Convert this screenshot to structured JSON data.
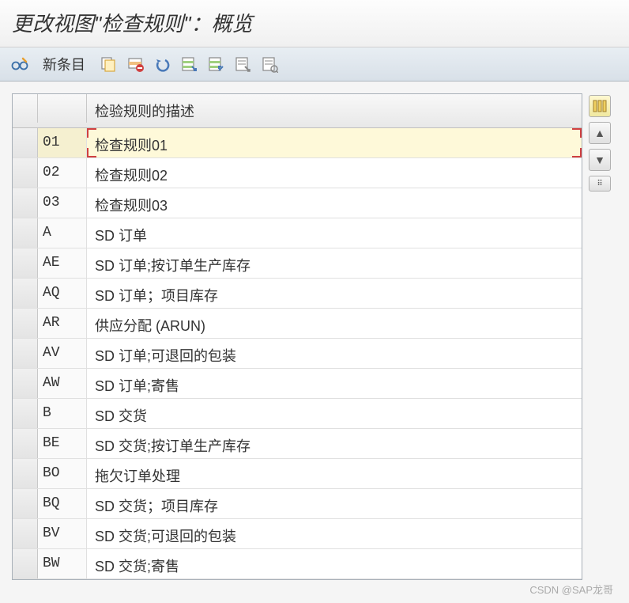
{
  "title": "更改视图\"检查规则\"：概览",
  "toolbar": {
    "new_entry_label": "新条目"
  },
  "table": {
    "header_desc": "检验规则的描述",
    "rows": [
      {
        "code": "01",
        "desc": "检查规则01",
        "selected": true
      },
      {
        "code": "02",
        "desc": "检查规则02",
        "selected": false
      },
      {
        "code": "03",
        "desc": "检查规则03",
        "selected": false
      },
      {
        "code": "A",
        "desc": "SD 订单",
        "selected": false
      },
      {
        "code": "AE",
        "desc": "SD 订单;按订单生产库存",
        "selected": false
      },
      {
        "code": "AQ",
        "desc": "SD 订单；项目库存",
        "selected": false
      },
      {
        "code": "AR",
        "desc": "供应分配 (ARUN)",
        "selected": false
      },
      {
        "code": "AV",
        "desc": "SD 订单;可退回的包装",
        "selected": false
      },
      {
        "code": "AW",
        "desc": "SD 订单;寄售",
        "selected": false
      },
      {
        "code": "B",
        "desc": "SD 交货",
        "selected": false
      },
      {
        "code": "BE",
        "desc": "SD 交货;按订单生产库存",
        "selected": false
      },
      {
        "code": "BO",
        "desc": "拖欠订单处理",
        "selected": false
      },
      {
        "code": "BQ",
        "desc": "SD 交货；项目库存",
        "selected": false
      },
      {
        "code": "BV",
        "desc": "SD 交货;可退回的包装",
        "selected": false
      },
      {
        "code": "BW",
        "desc": "SD 交货;寄售",
        "selected": false
      }
    ]
  },
  "watermark": "CSDN @SAP龙哥"
}
